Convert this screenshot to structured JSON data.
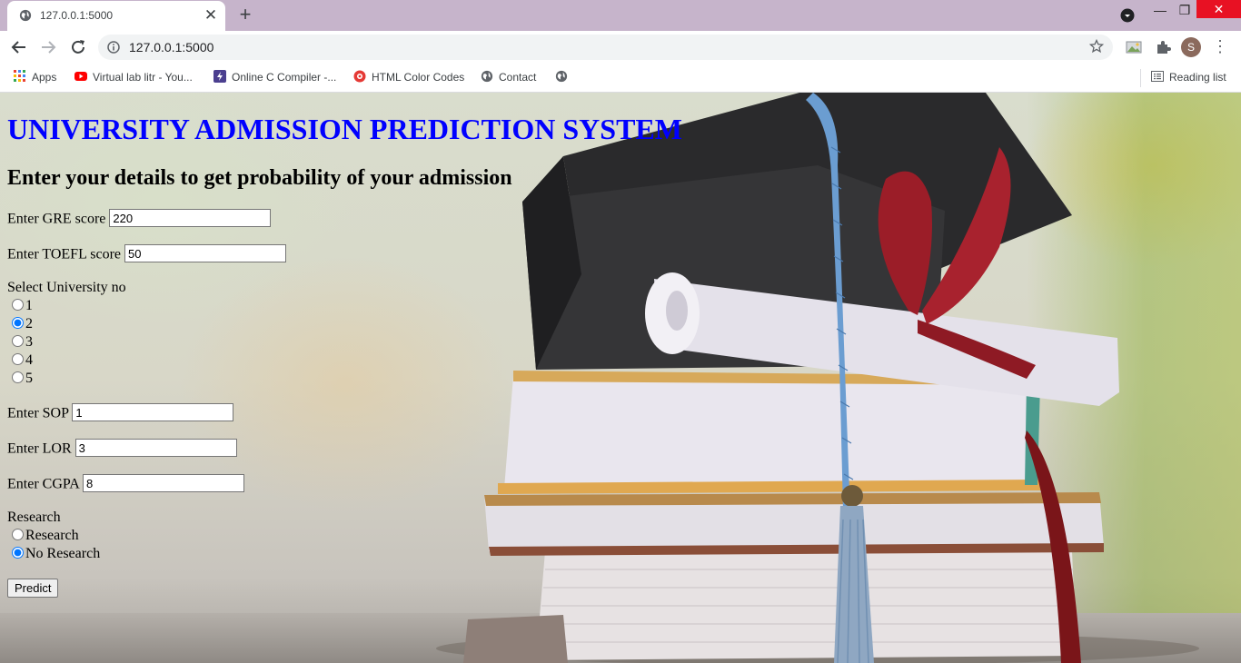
{
  "browser": {
    "tab_title": "127.0.0.1:5000",
    "url": "127.0.0.1:5000",
    "profile_initial": "S",
    "bookmarks": [
      {
        "label": "Apps",
        "icon": "apps-grid-icon"
      },
      {
        "label": "Virtual lab litr - You...",
        "icon": "youtube-icon"
      },
      {
        "label": "Online C Compiler -...",
        "icon": "compiler-icon"
      },
      {
        "label": "HTML Color Codes",
        "icon": "color-codes-icon"
      },
      {
        "label": "Contact",
        "icon": "globe-icon"
      },
      {
        "label": "",
        "icon": "globe-icon"
      }
    ],
    "reading_list": "Reading list"
  },
  "page": {
    "title": "UNIVERSITY ADMISSION PREDICTION SYSTEM",
    "subtitle": "Enter your details to get probability of your admission",
    "gre": {
      "label": "Enter GRE score",
      "value": "220"
    },
    "toefl": {
      "label": "Enter TOEFL score",
      "value": "50"
    },
    "university": {
      "label": "Select University no",
      "options": [
        "1",
        "2",
        "3",
        "4",
        "5"
      ],
      "selected": "2"
    },
    "sop": {
      "label": "Enter SOP",
      "value": "1"
    },
    "lor": {
      "label": "Enter LOR",
      "value": "3"
    },
    "cgpa": {
      "label": "Enter CGPA",
      "value": "8"
    },
    "research": {
      "label": "Research",
      "options": [
        "Research",
        "No Research"
      ],
      "selected": "No Research"
    },
    "predict_button": "Predict"
  },
  "colors": {
    "title": "#0000ff",
    "tab_strip": "#c6b4cb",
    "close_button": "#e81123"
  }
}
